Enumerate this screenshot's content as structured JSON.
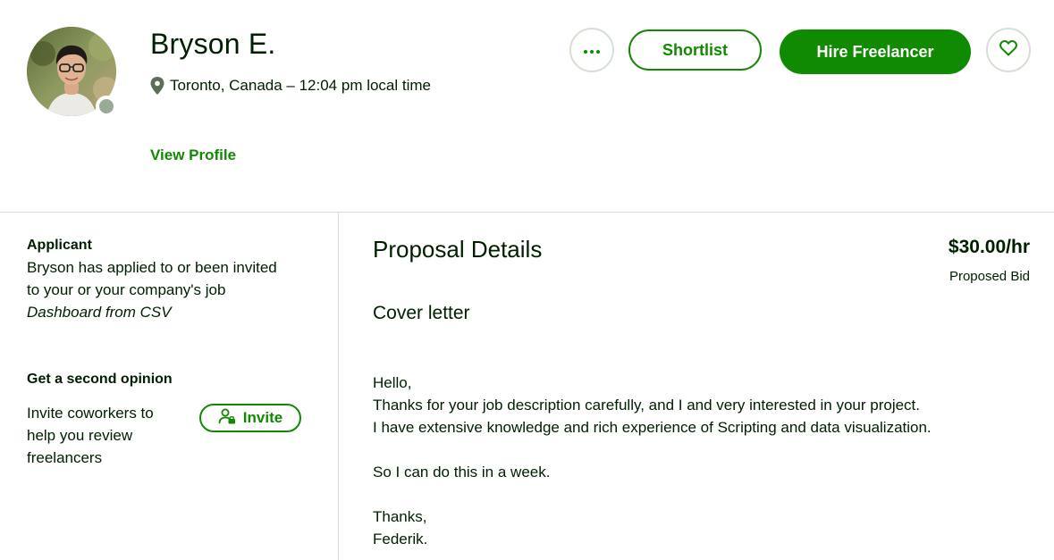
{
  "freelancer": {
    "name": "Bryson E.",
    "location": "Toronto, Canada – 12:04 pm local time",
    "view_profile": "View Profile",
    "avatar_icon": "freelancer-photo",
    "status": "offline"
  },
  "actions": {
    "more_icon": "ellipsis-icon",
    "shortlist_label": "Shortlist",
    "hire_label": "Hire Freelancer",
    "favorite_icon": "heart-icon"
  },
  "sidebar": {
    "applicant_heading": "Applicant",
    "applicant_line1": "Bryson has applied to or been invited",
    "applicant_line2": "to your or your company's job",
    "job_title": "Dashboard from CSV",
    "opinion_heading": "Get a second opinion",
    "invite_line1": "Invite coworkers to",
    "invite_line2": "help you review",
    "invite_line3": "freelancers",
    "invite_label": "Invite"
  },
  "proposal": {
    "title": "Proposal Details",
    "bid_amount": "$30.00/hr",
    "bid_label": "Proposed Bid",
    "cover_title": "Cover letter",
    "letter": {
      "greeting": "Hello,",
      "line1": "Thanks for your job description carefully, and I and very interested in your project.",
      "line2": "I have extensive knowledge and rich experience of Scripting and data visualization.",
      "line3": "So I can do this in a week.",
      "closing": "Thanks,",
      "signature": "Federik."
    }
  },
  "colors": {
    "brand_green": "#108a00",
    "text_dark": "#001e00",
    "border": "#d5e0d5"
  }
}
